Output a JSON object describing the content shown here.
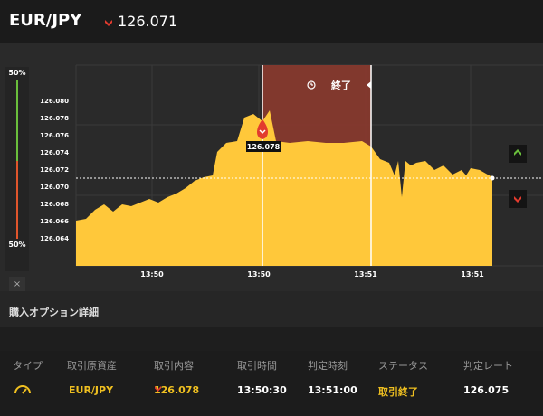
{
  "header": {
    "pair": "EUR/JPY",
    "price": "126.071",
    "direction": "down"
  },
  "leftpanel": {
    "top_pct": "50%",
    "bottom_pct": "50%",
    "close": "×"
  },
  "chart_data": {
    "type": "area",
    "y_ticks": [
      "126.080",
      "126.078",
      "126.076",
      "126.074",
      "126.072",
      "126.070",
      "126.068",
      "126.066",
      "126.064"
    ],
    "x_ticks": [
      "13:50",
      "13:50",
      "13:51",
      "13:51"
    ],
    "expiry_label": "終了",
    "marker_label": "126.078",
    "color": "#ffc83a"
  },
  "details": {
    "title": "購入オプション詳細",
    "columns": [
      "タイプ",
      "取引原資産",
      "取引内容",
      "取引時間",
      "判定時刻",
      "ステータス",
      "判定レート"
    ],
    "row": {
      "asset": "EUR/JPY",
      "content": "126.078",
      "trade_time": "13:50:30",
      "judge_time": "13:51:00",
      "status": "取引終了",
      "rate": "126.075"
    }
  }
}
